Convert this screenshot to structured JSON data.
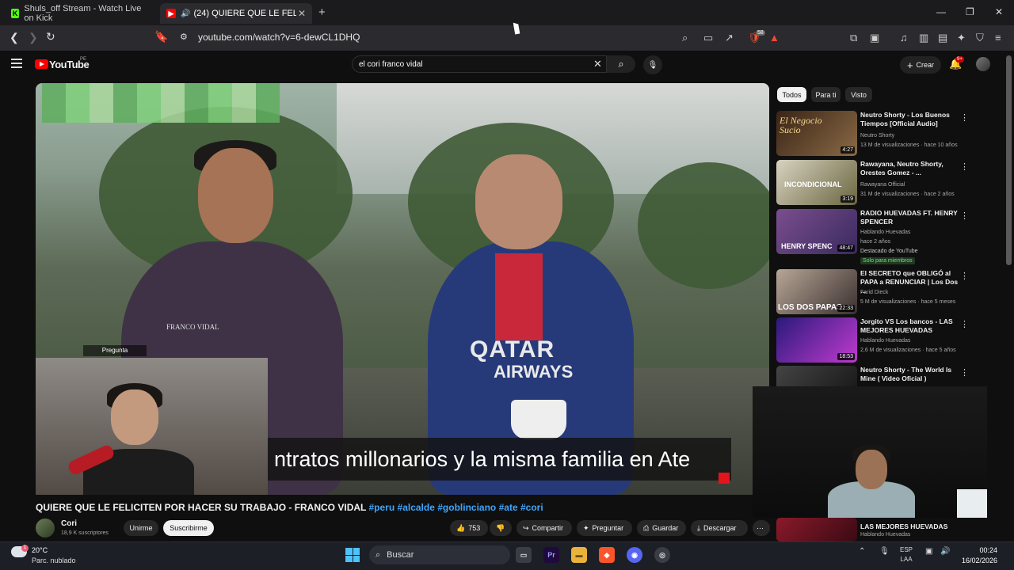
{
  "browser": {
    "tabs": [
      {
        "title": "Shuls_off Stream - Watch Live on Kick",
        "active": false
      },
      {
        "title": "(24) QUIERE QUE LE FELICITEN",
        "active": true
      }
    ],
    "url": "youtube.com/watch?v=6-dewCL1DHQ",
    "brave_badge": "58"
  },
  "youtube": {
    "logo_text": "YouTube",
    "region": "PE",
    "search_value": "el cori franco vidal",
    "create_label": "Crear",
    "notifications": "9+"
  },
  "video": {
    "subtitle": "ntratos millonarios y la misma familia en Ate",
    "facecam_label": "Pregunta",
    "shirt_text_1": "QATAR",
    "shirt_text_2": "AIRWAYS",
    "shirt_text_3": "FRANCO VIDAL"
  },
  "title": {
    "main": "QUIERE QUE LE FELICITEN POR HACER SU TRABAJO - FRANCO VIDAL",
    "hashtags": [
      "#peru",
      "#alcalde",
      "#goblinciano",
      "#ate",
      "#cori"
    ]
  },
  "channel": {
    "name": "Cori",
    "subs": "18,9 K suscriptores",
    "join_label": "Unirme",
    "subscribe_label": "Suscribirme"
  },
  "actions": {
    "likes": "753",
    "share": "Compartir",
    "ask": "Preguntar",
    "save": "Guardar",
    "download": "Descargar"
  },
  "chips": [
    "Todos",
    "Para ti",
    "Visto"
  ],
  "recommendations": [
    {
      "title": "Neutro Shorty - Los Buenos Tiempos [Official Audio]",
      "channel": "Neutro Shorty",
      "meta": "13 M de visualizaciones · hace 10 años",
      "duration": "4:27",
      "color": "#5a3a2a"
    },
    {
      "title": "Rawayana, Neutro Shorty, Orestes Gomez - ...",
      "channel": "Rawayana Official",
      "meta": "31 M de visualizaciones · hace 2 años",
      "duration": "3:19",
      "color": "#6d6a3a"
    },
    {
      "title": "RADIO HUEVADAS FT. HENRY SPENCER",
      "channel": "Hablando Huevadas",
      "meta": "hace 2 años",
      "extra": "Destacado de YouTube",
      "badge": "Solo para miembros",
      "duration": "48:47",
      "color": "#5a3c6d"
    },
    {
      "title": "El SECRETO que OBLIGÓ al PAPA a RENUNCIAR | Los Dos ...",
      "channel": "Farid Dieck",
      "meta": "5 M de visualizaciones · hace 5 meses",
      "duration": "22:33",
      "color": "#4a4a4a"
    },
    {
      "title": "Jorgito VS Los bancos - LAS MEJORES HUEVADAS",
      "channel": "Hablando Huevadas",
      "meta": "2,6 M de visualizaciones · hace 5 años",
      "duration": "18:53",
      "color": "#6a2c8a"
    },
    {
      "title": "Neutro Shorty - The World Is Mine ( Video Oficial )",
      "channel": "",
      "meta": "",
      "duration": "",
      "color": "#2a2a2a"
    },
    {
      "title": "LAS MEJORES HUEVADAS",
      "channel": "Hablando Huevadas",
      "meta": "",
      "duration": "",
      "color": "#7a2a3a"
    }
  ],
  "thumb_text": {
    "t1": "El Negocio Sucio",
    "t2": "INCONDICIONAL",
    "t3": "HENRY SPENC",
    "t4": "LOS DOS PAPAS"
  },
  "taskbar": {
    "temp": "20°C",
    "weather": "Parc. nublado",
    "weather_badge": "1",
    "search": "Buscar",
    "lang1": "ESP",
    "lang2": "LAA",
    "time": "00:24",
    "date": "16/02/2026"
  }
}
